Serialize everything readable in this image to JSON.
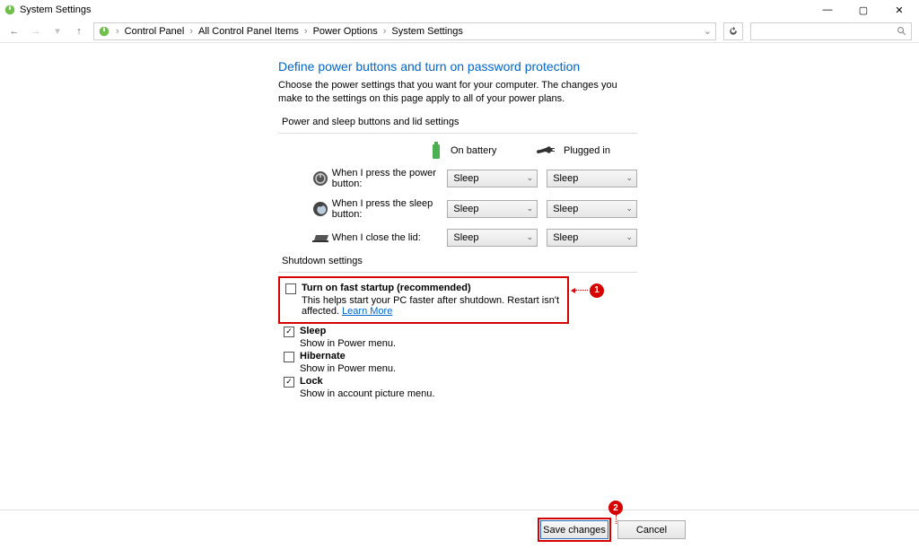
{
  "window": {
    "title": "System Settings"
  },
  "breadcrumb": {
    "items": [
      "Control Panel",
      "All Control Panel Items",
      "Power Options",
      "System Settings"
    ]
  },
  "page": {
    "title": "Define power buttons and turn on password protection",
    "description": "Choose the power settings that you want for your computer. The changes you make to the settings on this page apply to all of your power plans.",
    "section_power": "Power and sleep buttons and lid settings",
    "section_shutdown": "Shutdown settings",
    "col_battery": "On battery",
    "col_plugged": "Plugged in"
  },
  "rows": {
    "power_btn": {
      "label": "When I press the power button:",
      "battery": "Sleep",
      "plugged": "Sleep"
    },
    "sleep_btn": {
      "label": "When I press the sleep button:",
      "battery": "Sleep",
      "plugged": "Sleep"
    },
    "lid": {
      "label": "When I close the lid:",
      "battery": "Sleep",
      "plugged": "Sleep"
    }
  },
  "shutdown": {
    "faststart": {
      "label": "Turn on fast startup (recommended)",
      "desc": "This helps start your PC faster after shutdown. Restart isn't affected.",
      "link": "Learn More",
      "checked": false
    },
    "sleep": {
      "label": "Sleep",
      "desc": "Show in Power menu.",
      "checked": true
    },
    "hibernate": {
      "label": "Hibernate",
      "desc": "Show in Power menu.",
      "checked": false
    },
    "lock": {
      "label": "Lock",
      "desc": "Show in account picture menu.",
      "checked": true
    }
  },
  "buttons": {
    "save": "Save changes",
    "cancel": "Cancel"
  },
  "annotations": {
    "one": "1",
    "two": "2"
  }
}
